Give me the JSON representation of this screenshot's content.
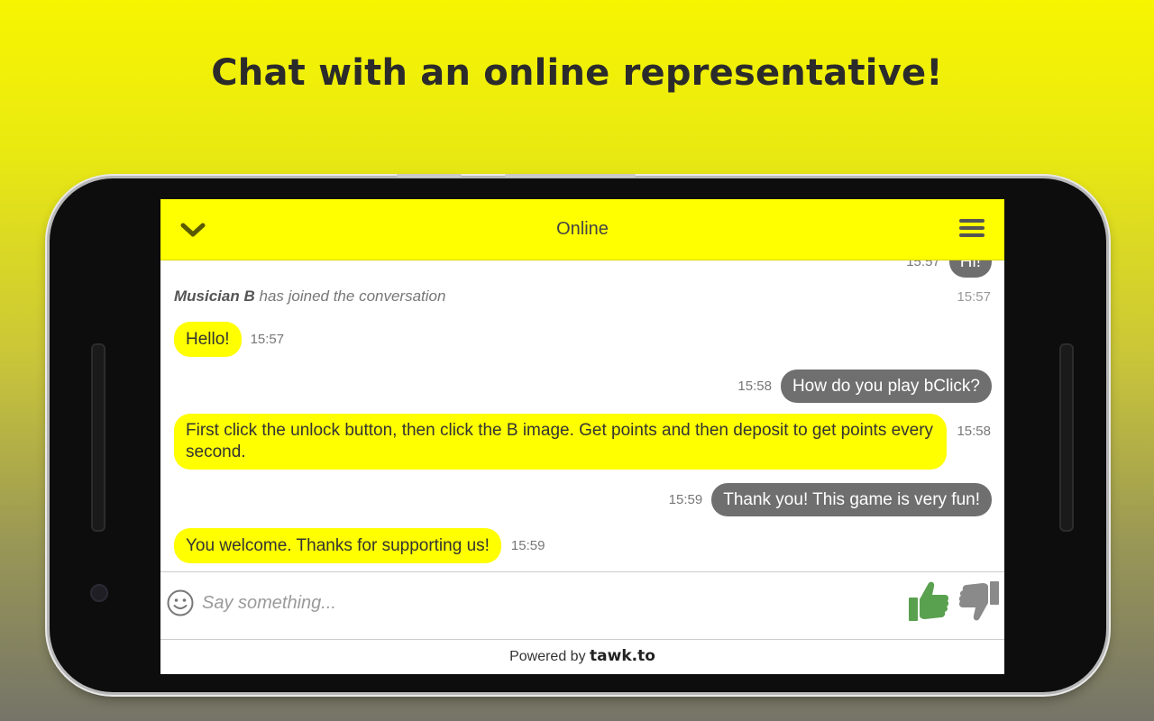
{
  "headline": "Chat with an online representative!",
  "chat": {
    "status": "Online",
    "partial_message": {
      "text": "Hi!",
      "time": "15:57"
    },
    "system_message": {
      "agent": "Musician B",
      "text": "has joined the conversation",
      "time": "15:57"
    },
    "messages": [
      {
        "from": "agent",
        "text": "Hello!",
        "time": "15:57"
      },
      {
        "from": "user",
        "text": "How do you play bClick?",
        "time": "15:58"
      },
      {
        "from": "agent",
        "text": "First click the unlock button, then click the B image. Get points and then deposit to get points every second.",
        "time": "15:58"
      },
      {
        "from": "user",
        "text": "Thank you! This game is very fun!",
        "time": "15:59"
      },
      {
        "from": "agent",
        "text": "You welcome. Thanks for supporting us!",
        "time": "15:59"
      }
    ],
    "composer": {
      "placeholder": "Say something..."
    },
    "footer": {
      "powered_by": "Powered by",
      "brand": "tawk.to"
    }
  },
  "colors": {
    "accent": "#ffff00",
    "user_bubble": "#6f6f6f",
    "thumbs_up": "#5aa14f",
    "thumbs_down": "#8a8a8a"
  },
  "icons": [
    "chevron-down-icon",
    "hamburger-menu-icon",
    "emoji-icon",
    "thumbs-up-icon",
    "thumbs-down-icon"
  ]
}
